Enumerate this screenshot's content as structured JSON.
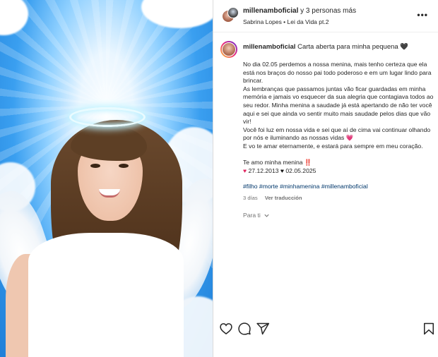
{
  "header": {
    "username": "millenamboficial",
    "coauthors_suffix": "y 3 personas más",
    "subline": "Sabrina Lopes • Lei da Vida pt.2",
    "more_icon": "more-horizontal-icon",
    "more_glyph": "•••"
  },
  "caption": {
    "username": "millenamboficial",
    "title": "Carta aberta para minha pequena 🖤",
    "paragraphs": [
      "No dia 02.05 perdemos a nossa menina, mais tenho certeza que ela está nos braços do nosso pai todo poderoso e em um lugar lindo para brincar.",
      "As lembranças que passamos juntas vão ficar guardadas em minha memória e jamais vo esquecer da sua alegria que contagiava todos ao seu redor. Minha menina a saudade já está apertando de não ter você aqui e sei que ainda vo sentir muito mais saudade pelos dias que vão vir!",
      "Você foi luz em nossa vida e sei que aí de cima vai continuar olhando por nós e iluminando as nossas vidas 💗",
      "E vo te amar eternamente, e estará para sempre em meu coração."
    ],
    "closing": "Te amo minha menina ‼️",
    "dates": {
      "birth_heart": "♥",
      "birth": "27.12.2013",
      "death_heart": "♥",
      "death": "02.05.2025"
    },
    "hashtags": "#filho #morte #minhamenina #millenamboficial",
    "time_ago": "3 días",
    "translate": "Ver traducción",
    "for_you": "Para ti"
  },
  "actions": {
    "icons": [
      "heart-icon",
      "comment-icon",
      "share-icon",
      "bookmark-icon"
    ]
  },
  "colors": {
    "link": "#00376b",
    "muted": "#737373",
    "text": "#262626"
  }
}
